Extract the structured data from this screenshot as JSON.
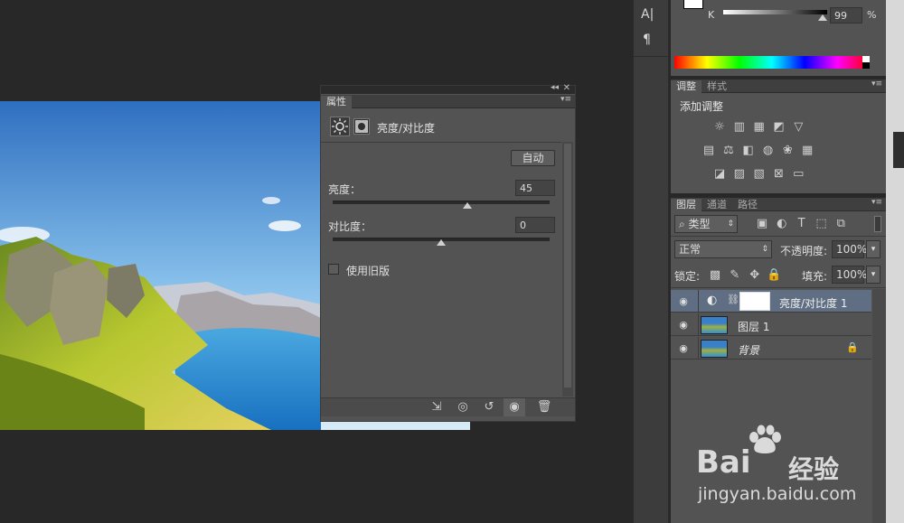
{
  "properties_panel": {
    "tab_label": "属性",
    "title": "亮度/对比度",
    "auto_button": "自动",
    "brightness_label": "亮度：",
    "brightness_value": "45",
    "brightness_fraction": 0.62,
    "contrast_label": "对比度：",
    "contrast_value": "0",
    "contrast_fraction": 0.5,
    "legacy_checkbox_label": "使用旧版"
  },
  "tool_column": {
    "text_tool": "A|",
    "paragraph_tool": "¶"
  },
  "color_panel": {
    "k_label": "K",
    "k_value": "99",
    "percent": "%"
  },
  "adjustments_panel": {
    "tabs": [
      "调整",
      "样式"
    ],
    "add_label": "添加调整"
  },
  "layers_panel": {
    "tabs": [
      "图层",
      "通道",
      "路径"
    ],
    "filter_type": "类型",
    "blend_mode": "正常",
    "opacity_label": "不透明度:",
    "opacity_value": "100%",
    "lock_label": "锁定:",
    "fill_label": "填充:",
    "fill_value": "100%",
    "layers": [
      {
        "name": "亮度/对比度 1",
        "selected": true,
        "kind": "adjustment"
      },
      {
        "name": "图层 1",
        "selected": false,
        "kind": "image"
      },
      {
        "name": "背景",
        "selected": false,
        "kind": "background",
        "locked": true
      }
    ]
  },
  "watermark": {
    "brand": "Bai",
    "brand_cn": "经验",
    "url": "jingyan.baidu.com"
  }
}
